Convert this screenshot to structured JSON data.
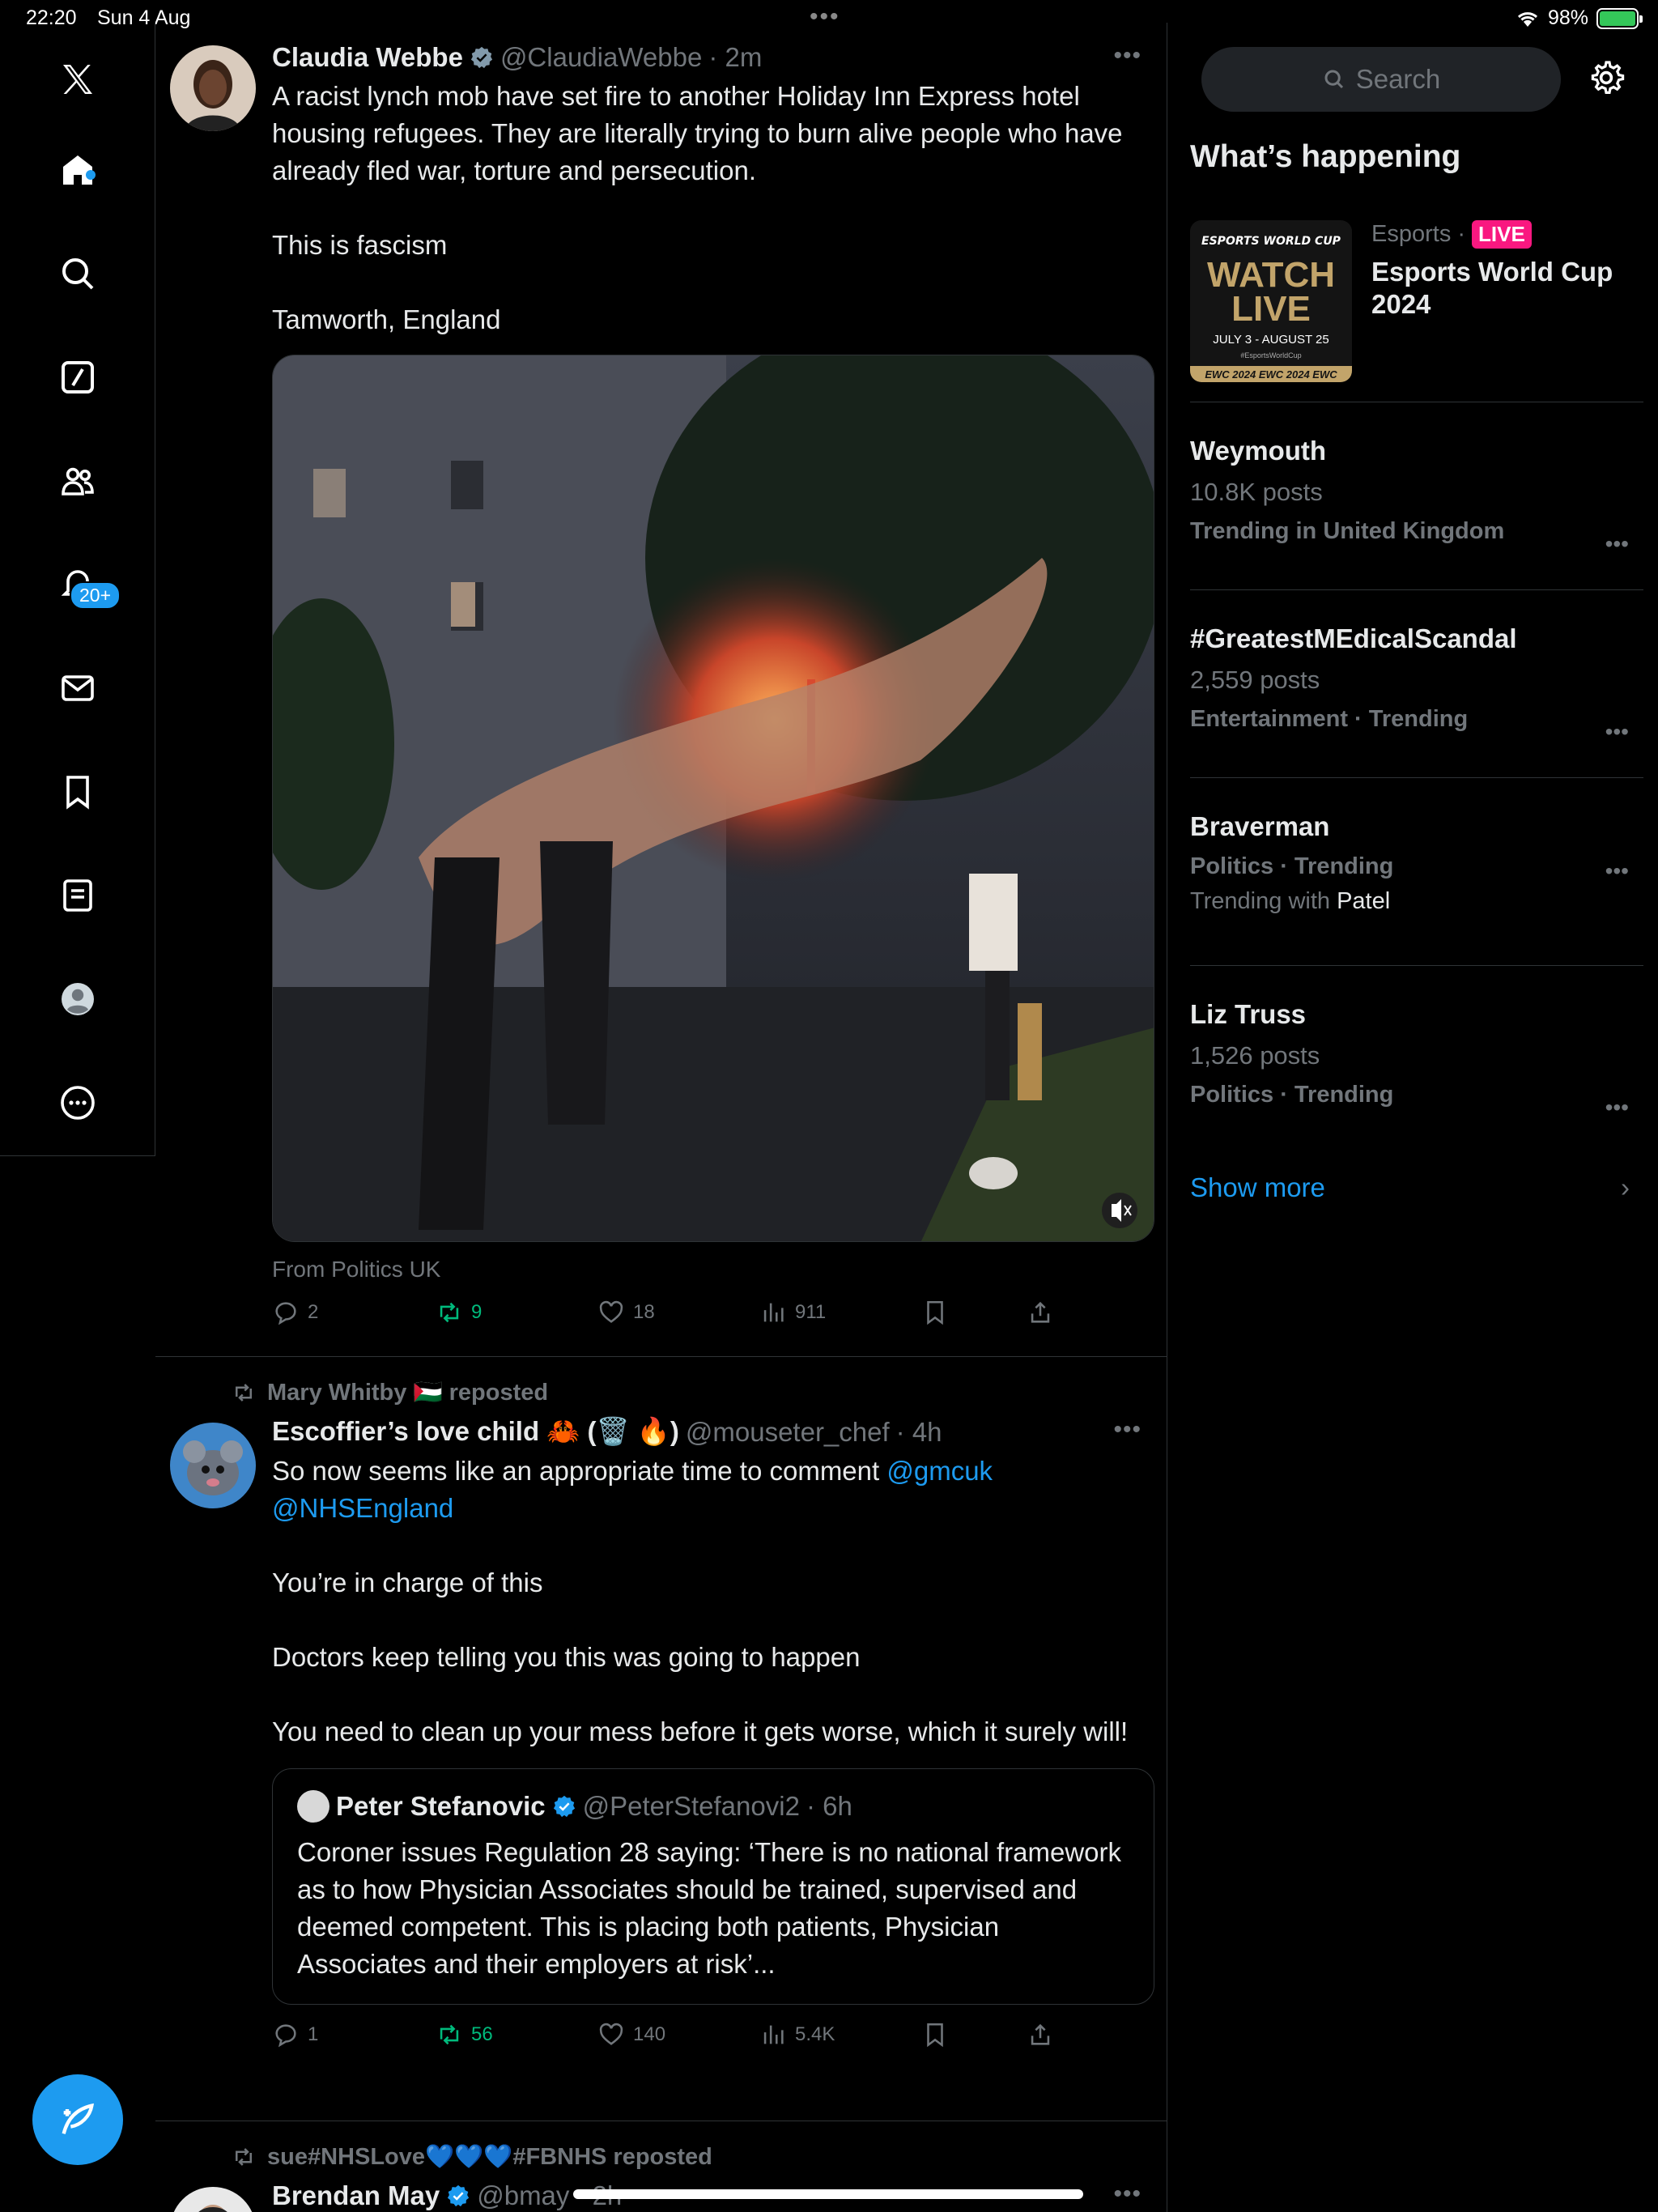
{
  "status_bar": {
    "time": "22:20",
    "date": "Sun 4 Aug",
    "battery": "98%"
  },
  "nav": {
    "notification_badge": "20+"
  },
  "tweets": [
    {
      "name": "Claudia Webbe",
      "handle": "@ClaudiaWebbe",
      "time": "· 2m",
      "text": "A racist lynch mob have set fire to another Holiday Inn Express hotel housing refugees. They are literally trying to burn alive people who have already fled war, torture and persecution.\n\nThis is fascism\n\nTamworth, England",
      "source": "From Politics UK",
      "replies": "2",
      "reposts": "9",
      "likes": "18",
      "views": "911"
    },
    {
      "reposted_by": "Mary Whitby 🇵🇸 reposted",
      "name": "Escoffier’s love child 🦀 (🗑️ 🔥)",
      "handle": "@mouseter_chef",
      "time": "· 4h",
      "text_1": "So now seems like an appropriate time to comment ",
      "mention_1": "@gmcuk",
      "mention_2": "@NHSEngland",
      "text_2": "You’re in charge of this\n\nDoctors keep telling you this was going to happen\n\nYou need to clean up your mess before it gets worse, which it surely will!",
      "quote": {
        "name": "Peter Stefanovic",
        "handle": "@PeterStefanovi2",
        "time": "· 6h",
        "text": "Coroner issues Regulation 28 saying: ‘There is no national framework as to how Physician Associates should be trained, supervised and deemed competent. This is placing both patients, Physician Associates and their employers at risk’..."
      },
      "replies": "1",
      "reposts": "56",
      "likes": "140",
      "views": "5.4K"
    },
    {
      "reposted_by": "sue#NHSLove💙💙💙#FBNHS reposted",
      "name": "Brendan May",
      "handle": "@bmay",
      "time": "· 2h"
    }
  ],
  "sidebar": {
    "search_placeholder": "Search",
    "title": "What’s happening",
    "esports": {
      "category": "Esports ·",
      "live": "LIVE",
      "title": "Esports World Cup 2024",
      "image_text": {
        "brand": "ESPORTS WORLD CUP",
        "watch": "WATCH",
        "live": "LIVE",
        "dates": "JULY 3 - AUGUST 25",
        "tag": "#EsportsWorldCup",
        "strip": "EWC 2024 EWC 2024 EWC"
      }
    },
    "trends": [
      {
        "name": "Weymouth",
        "posts": "10.8K posts",
        "category": "Trending in United Kingdom"
      },
      {
        "name": "#GreatestMEdicalScandal",
        "posts": "2,559 posts",
        "category": "Entertainment · Trending"
      },
      {
        "name": "Braverman",
        "category": "Politics · Trending",
        "with_label": "Trending with ",
        "with_value": "Patel"
      },
      {
        "name": "Liz Truss",
        "posts": "1,526 posts",
        "category": "Politics · Trending"
      }
    ],
    "show_more": "Show more"
  },
  "colors": {
    "accent": "#1d9bf0",
    "repost_green": "#00ba7c",
    "live_pink": "#f91880"
  }
}
